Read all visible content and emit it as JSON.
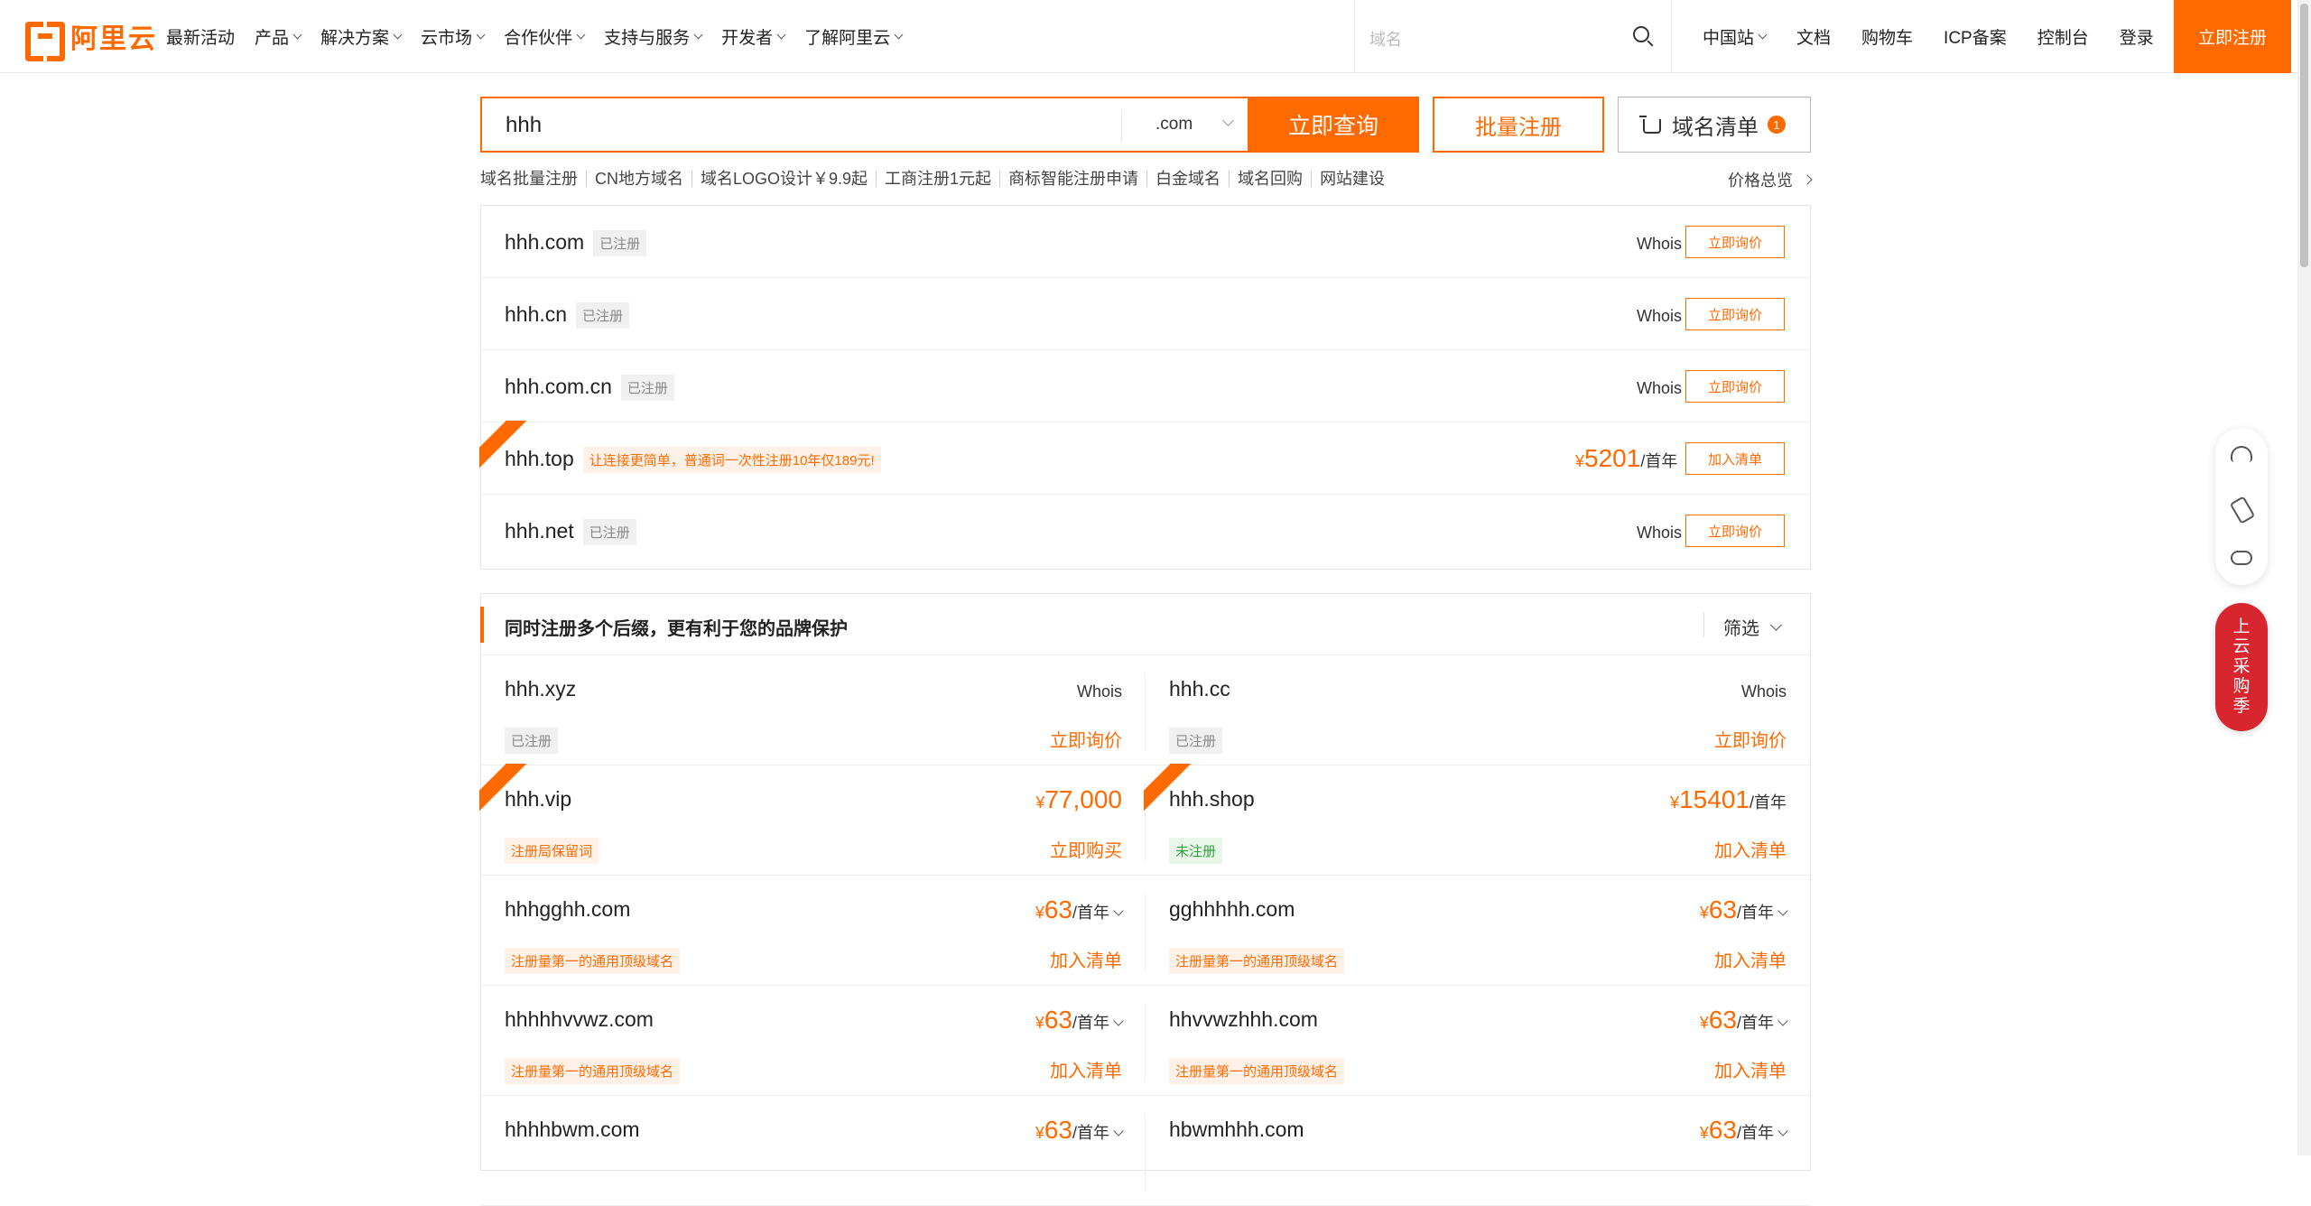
{
  "nav": {
    "logo_text": "阿里云",
    "links": [
      "最新活动",
      "产品",
      "解决方案",
      "云市场",
      "合作伙伴",
      "支持与服务",
      "开发者",
      "了解阿里云"
    ],
    "search_placeholder": "域名",
    "right": [
      "中国站",
      "文档",
      "购物车",
      "ICP备案",
      "控制台",
      "登录"
    ],
    "register": "立即注册"
  },
  "search": {
    "value": "hhh",
    "suffix": ".com",
    "query_btn": "立即查询",
    "batch_btn": "批量注册",
    "list_btn": "域名清单",
    "list_count": "1"
  },
  "quick_links": [
    "域名批量注册",
    "CN地方域名",
    "域名LOGO设计￥9.9起",
    "工商注册1元起",
    "商标智能注册申请",
    "白金域名",
    "域名回购",
    "网站建设"
  ],
  "price_overview": "价格总览",
  "top_results": [
    {
      "domain": "hhh.com",
      "tag": "已注册",
      "whois": "Whois",
      "action": "立即询价"
    },
    {
      "domain": "hhh.cn",
      "tag": "已注册",
      "whois": "Whois",
      "action": "立即询价"
    },
    {
      "domain": "hhh.com.cn",
      "tag": "已注册",
      "whois": "Whois",
      "action": "立即询价"
    },
    {
      "domain": "hhh.top",
      "tag": "让连接更简单，普通词一次性注册10年仅189元!",
      "currency": "¥",
      "price": "5201",
      "unit": "/首年",
      "action": "加入清单"
    },
    {
      "domain": "hhh.net",
      "tag": "已注册",
      "whois": "Whois",
      "action": "立即询价"
    }
  ],
  "section": {
    "title": "同时注册多个后缀，更有利于您的品牌保护",
    "filter": "筛选",
    "items": [
      {
        "domain": "hhh.xyz",
        "tag": "已注册",
        "whois": "Whois",
        "action": "立即询价"
      },
      {
        "domain": "hhh.cc",
        "tag": "已注册",
        "whois": "Whois",
        "action": "立即询价"
      },
      {
        "domain": "hhh.vip",
        "tag": "注册局保留词",
        "currency": "¥",
        "price": "77,000",
        "action": "立即购买"
      },
      {
        "domain": "hhh.shop",
        "tag": "未注册",
        "currency": "¥",
        "price": "15401",
        "unit": "/首年",
        "action": "加入清单"
      },
      {
        "domain": "hhhgghh.com",
        "tag": "注册量第一的通用顶级域名",
        "currency": "¥",
        "price": "63",
        "unit": "/首年",
        "action": "加入清单"
      },
      {
        "domain": "gghhhhh.com",
        "tag": "注册量第一的通用顶级域名",
        "currency": "¥",
        "price": "63",
        "unit": "/首年",
        "action": "加入清单"
      },
      {
        "domain": "hhhhhvvwz.com",
        "tag": "注册量第一的通用顶级域名",
        "currency": "¥",
        "price": "63",
        "unit": "/首年",
        "action": "加入清单"
      },
      {
        "domain": "hhvvwzhhh.com",
        "tag": "注册量第一的通用顶级域名",
        "currency": "¥",
        "price": "63",
        "unit": "/首年",
        "action": "加入清单"
      },
      {
        "domain": "hhhhbwm.com",
        "currency": "¥",
        "price": "63",
        "unit": "/首年"
      },
      {
        "domain": "hbwmhhh.com",
        "currency": "¥",
        "price": "63",
        "unit": "/首年"
      }
    ]
  },
  "promo": [
    "上",
    "云",
    "采",
    "购",
    "季"
  ],
  "colors": {
    "accent": "#ff6a00",
    "promo": "#d7262e"
  }
}
